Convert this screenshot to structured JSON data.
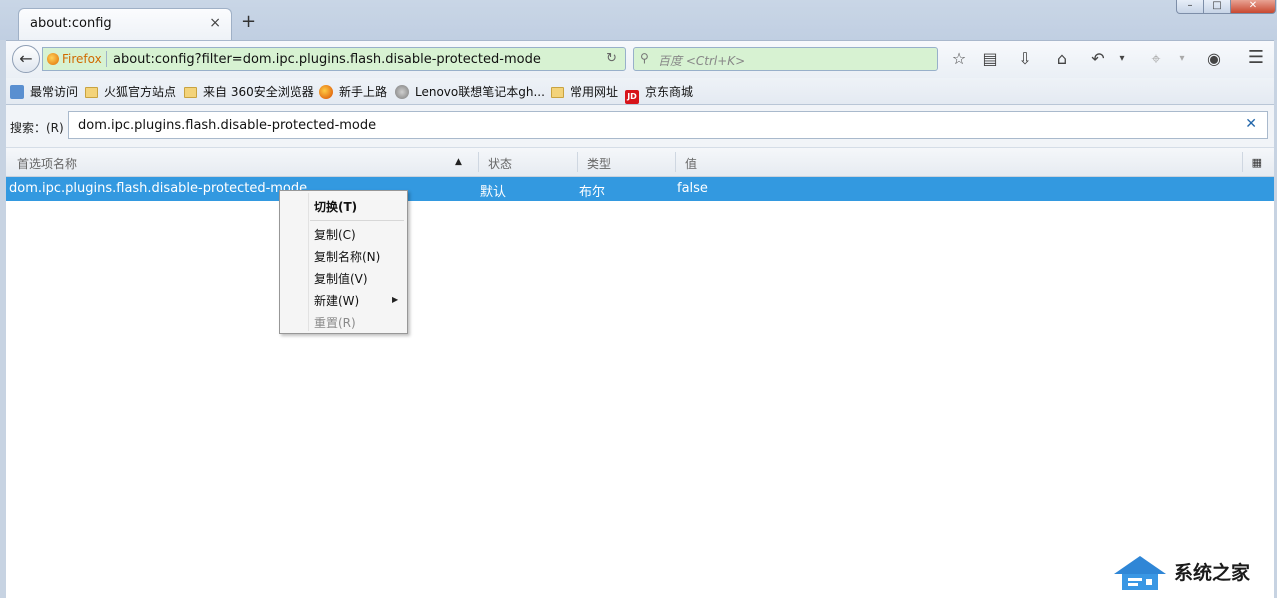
{
  "tab": {
    "title": "about:config",
    "close": "×",
    "new_tab": "+"
  },
  "window_controls": {
    "min": "–",
    "max": "□",
    "close": "✕"
  },
  "navbar": {
    "identity": "Firefox",
    "url": "about:config?filter=dom.ipc.plugins.flash.disable-protected-mode",
    "search_placeholder": "百度 <Ctrl+K>"
  },
  "bookmarks": [
    {
      "label": "最常访问",
      "icon": "most-visited-icon"
    },
    {
      "label": "火狐官方站点",
      "icon": "folder-icon"
    },
    {
      "label": "来自 360安全浏览器",
      "icon": "folder-icon"
    },
    {
      "label": "新手上路",
      "icon": "firefox-icon"
    },
    {
      "label": "Lenovo联想笔记本gh...",
      "icon": "globe-icon"
    },
    {
      "label": "常用网址",
      "icon": "folder-icon"
    },
    {
      "label": "京东商城",
      "icon": "jd-icon"
    }
  ],
  "filter": {
    "label": "搜索：(R)",
    "value": "dom.ipc.plugins.flash.disable-protected-mode",
    "clear": "✕"
  },
  "table": {
    "columns": [
      "首选项名称",
      "状态",
      "类型",
      "值"
    ],
    "rows": [
      {
        "name": "dom.ipc.plugins.flash.disable-protected-mode",
        "status": "默认",
        "type": "布尔",
        "value": "false"
      }
    ]
  },
  "context_menu": {
    "items": [
      {
        "label": "切换(T)",
        "bold": true
      },
      {
        "label": "复制(C)"
      },
      {
        "label": "复制名称(N)"
      },
      {
        "label": "复制值(V)"
      },
      {
        "label": "新建(W)",
        "submenu": true
      },
      {
        "label": "重置(R)",
        "disabled": true
      }
    ]
  },
  "watermark": {
    "text": "系统之家"
  },
  "colors": {
    "selection": "#3399e0",
    "urlbar_bg": "#d7f2d2",
    "identity": "#d06a00"
  }
}
